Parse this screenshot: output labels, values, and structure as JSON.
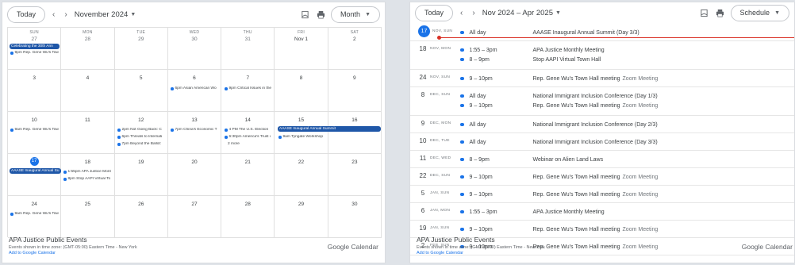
{
  "month": {
    "today_label": "Today",
    "title": "November 2024",
    "view_label": "Month",
    "weeks": [
      [
        {
          "dow": "SUN",
          "num": "27"
        },
        {
          "dow": "MON",
          "num": "28"
        },
        {
          "dow": "TUE",
          "num": "29"
        },
        {
          "dow": "WED",
          "num": "30"
        },
        {
          "dow": "THU",
          "num": "31"
        },
        {
          "dow": "FRI",
          "num": "Nov 1"
        },
        {
          "dow": "SAT",
          "num": "2"
        }
      ],
      [
        {
          "num": "3"
        },
        {
          "num": "4"
        },
        {
          "num": "5"
        },
        {
          "num": "6"
        },
        {
          "num": "7"
        },
        {
          "num": "8"
        },
        {
          "num": "9"
        }
      ],
      [
        {
          "num": "10"
        },
        {
          "num": "11"
        },
        {
          "num": "12"
        },
        {
          "num": "13"
        },
        {
          "num": "14"
        },
        {
          "num": "15"
        },
        {
          "num": "16"
        }
      ],
      [
        {
          "num": "17"
        },
        {
          "num": "18"
        },
        {
          "num": "19"
        },
        {
          "num": "20"
        },
        {
          "num": "21"
        },
        {
          "num": "22"
        },
        {
          "num": "23"
        }
      ],
      [
        {
          "num": "24"
        },
        {
          "num": "25"
        },
        {
          "num": "26"
        },
        {
          "num": "27"
        },
        {
          "num": "28"
        },
        {
          "num": "29"
        },
        {
          "num": "30"
        }
      ]
    ],
    "events": {
      "w0_sun_bar": "Celebrating the 30th Ann",
      "w0_sun_dot": "9pm Rep. Gene Wu's Tow",
      "w1_wed": "6pm Asian American Wo",
      "w1_thu": "9pm Critical Issues in the",
      "w2_sun": "9am Rep. Gene Wu's Tow",
      "w2_tue_1": "2pm Not Going Back: C",
      "w2_tue_2": "6pm Threats to Internati",
      "w2_tue_3": "7pm Beyond the Ballot: ",
      "w2_wed": "7pm China's Economic T",
      "w2_thu_1": "4 PM The U.S. Election",
      "w2_thu_2": "6:30pm America's Trust i",
      "w2_thu_more": "2 more",
      "w2_fri_bar": "AAASE Inaugural Annual Summit",
      "w2_fri_dot": "9am Tyngate Workshop",
      "w3_sun_bar": "AAASE Inaugural Annual Su",
      "w3_mon_1": "1:55pm APA Justice Mont",
      "w3_mon_2": "8pm Stop AAPI Virtual To",
      "w4_sun": "9am Rep. Gene Wu's Tow"
    },
    "footer": {
      "title": "APA Justice Public Events",
      "timezone": "Events shown in time zone: (GMT-05:00) Eastern Time - New York",
      "add": "Add to Google Calendar",
      "brand": "Google Calendar"
    }
  },
  "schedule": {
    "today_label": "Today",
    "title": "Nov 2024 – Apr 2025",
    "view_label": "Schedule",
    "rows": [
      {
        "num": "17",
        "dow": "NOV, SUN",
        "today": true,
        "events": [
          {
            "time": "All day",
            "title": "AAASE Inaugural Annual Summit (Day 3/3)",
            "loc": ""
          }
        ]
      },
      {
        "num": "18",
        "dow": "NOV, MON",
        "events": [
          {
            "time": "1:55 – 3pm",
            "title": "APA Justice Monthly Meeting",
            "loc": ""
          },
          {
            "time": "8 – 9pm",
            "title": "Stop AAPI Virtual Town Hall",
            "loc": ""
          }
        ]
      },
      {
        "num": "24",
        "dow": "NOV, SUN",
        "events": [
          {
            "time": "9 – 10pm",
            "title": "Rep. Gene Wu's Town Hall meeting",
            "loc": "Zoom Meeting"
          }
        ]
      },
      {
        "num": "8",
        "dow": "DEC, SUN",
        "events": [
          {
            "time": "All day",
            "title": "National Immigrant Inclusion Conference (Day 1/3)",
            "loc": ""
          },
          {
            "time": "9 – 10pm",
            "title": "Rep. Gene Wu's Town Hall meeting",
            "loc": "Zoom Meeting"
          }
        ]
      },
      {
        "num": "9",
        "dow": "DEC, MON",
        "events": [
          {
            "time": "All day",
            "title": "National Immigrant Inclusion Conference (Day 2/3)",
            "loc": ""
          }
        ]
      },
      {
        "num": "10",
        "dow": "DEC, TUE",
        "events": [
          {
            "time": "All day",
            "title": "National Immigrant Inclusion Conference (Day 3/3)",
            "loc": ""
          }
        ]
      },
      {
        "num": "11",
        "dow": "DEC, WED",
        "events": [
          {
            "time": "8 – 9pm",
            "title": "Webinar on Alien Land Laws",
            "loc": ""
          }
        ]
      },
      {
        "num": "22",
        "dow": "DEC, SUN",
        "events": [
          {
            "time": "9 – 10pm",
            "title": "Rep. Gene Wu's Town Hall meeting",
            "loc": "Zoom Meeting"
          }
        ]
      },
      {
        "num": "5",
        "dow": "JAN, SUN",
        "events": [
          {
            "time": "9 – 10pm",
            "title": "Rep. Gene Wu's Town Hall meeting",
            "loc": "Zoom Meeting"
          }
        ]
      },
      {
        "num": "6",
        "dow": "JAN, MON",
        "events": [
          {
            "time": "1:55 – 3pm",
            "title": "APA Justice Monthly Meeting",
            "loc": ""
          }
        ]
      },
      {
        "num": "19",
        "dow": "JAN, SUN",
        "events": [
          {
            "time": "9 – 10pm",
            "title": "Rep. Gene Wu's Town Hall meeting",
            "loc": "Zoom Meeting"
          }
        ]
      },
      {
        "num": "2",
        "dow": "FEB, SUN",
        "events": [
          {
            "time": "9 – 10pm",
            "title": "Rep. Gene Wu's Town Hall meeting",
            "loc": "Zoom Meeting"
          }
        ]
      }
    ],
    "footer": {
      "title": "APA Justice Public Events",
      "timezone": "Events shown in time zone: (GMT-05:00) Eastern Time - New York",
      "add": "Add to Google Calendar",
      "brand": "Google Calendar"
    }
  },
  "colors": {
    "accent": "#1a73e8",
    "event_bar": "#1f57a8",
    "now_line": "#d93025"
  }
}
